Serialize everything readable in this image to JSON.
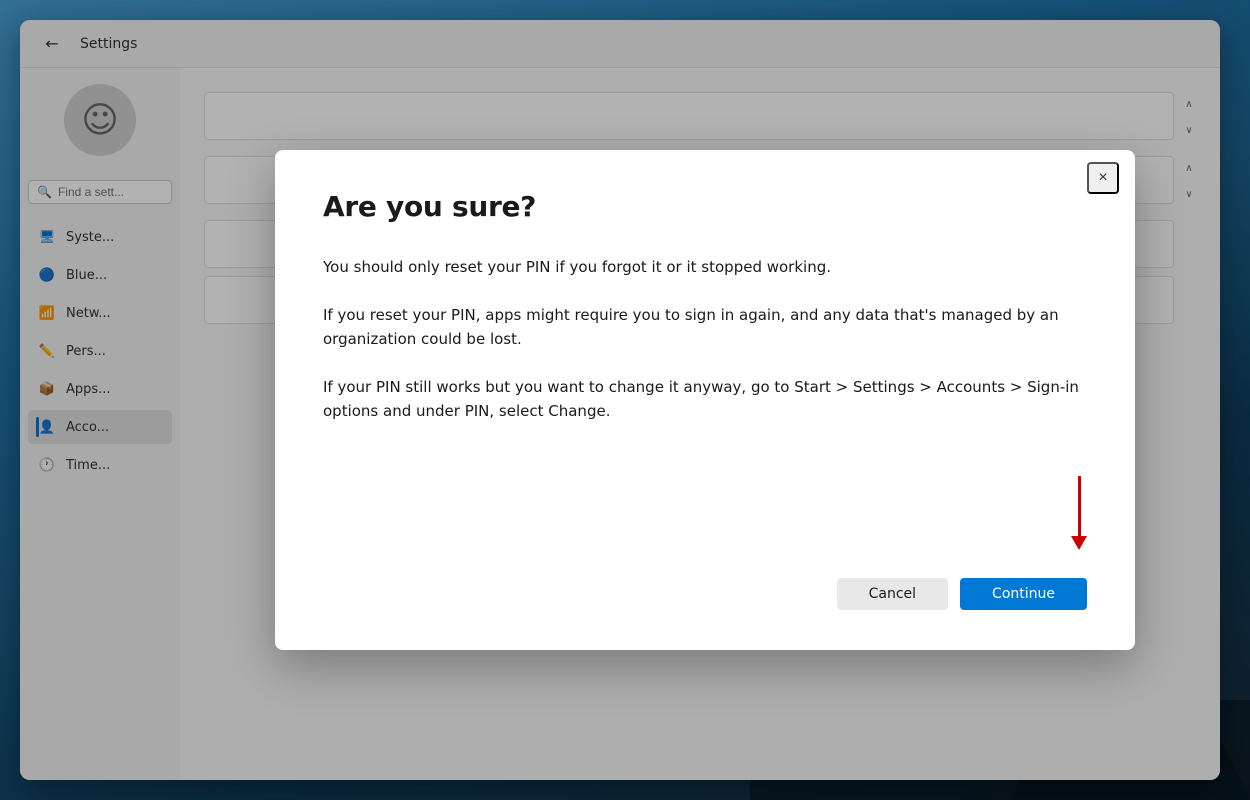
{
  "desktop": {
    "bg_description": "Windows desktop with ocean/mountain background"
  },
  "settings": {
    "title": "Settings",
    "back_label": "←",
    "search_placeholder": "Find a sett...",
    "nav_items": [
      {
        "id": "system",
        "label": "Syste...",
        "icon": "🖥",
        "active": false
      },
      {
        "id": "bluetooth",
        "label": "Blue...",
        "icon": "🔵",
        "active": false
      },
      {
        "id": "network",
        "label": "Netw...",
        "icon": "📶",
        "active": false
      },
      {
        "id": "personalization",
        "label": "Pers...",
        "icon": "✏",
        "active": false
      },
      {
        "id": "apps",
        "label": "Apps...",
        "icon": "📦",
        "active": false
      },
      {
        "id": "accounts",
        "label": "Acco...",
        "icon": "👤",
        "active": true
      },
      {
        "id": "time",
        "label": "Time...",
        "icon": "🕐",
        "active": false
      }
    ]
  },
  "dialog": {
    "title": "Are you sure?",
    "close_label": "×",
    "paragraphs": [
      "You should only reset your PIN if you forgot it or it stopped working.",
      "If you reset your PIN, apps might require you to sign in again, and any data that's managed by an organization could be lost.",
      "If your PIN still works but you want to change it anyway, go to Start > Settings > Accounts > Sign-in options and under PIN, select Change."
    ],
    "cancel_label": "Cancel",
    "continue_label": "Continue"
  },
  "scrollbar": {
    "up_arrow": "∧",
    "down_arrow_1": "∨",
    "up_arrow_2": "∧",
    "down_arrow_2": "∨"
  }
}
